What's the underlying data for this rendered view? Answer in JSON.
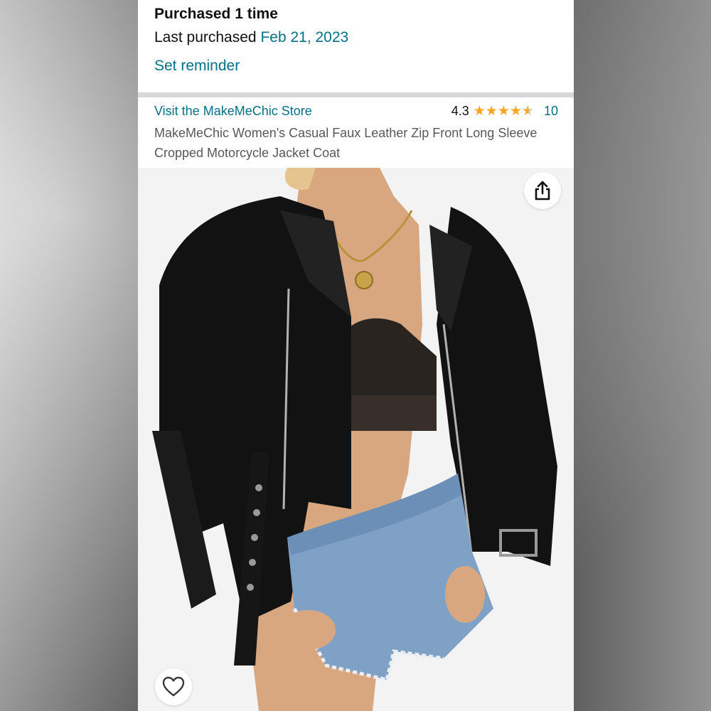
{
  "purchase": {
    "count_text": "Purchased 1 time",
    "last_label": "Last purchased",
    "last_date": "Feb 21, 2023",
    "reminder_label": "Set reminder"
  },
  "product": {
    "store_link": "Visit the MakeMeChic Store",
    "rating_value": "4.3",
    "rating_stars": 4.3,
    "rating_count": "10",
    "title": "MakeMeChic Women's Casual Faux Leather Zip Front Long Sleeve Cropped Motorcycle Jacket Coat"
  },
  "image": {
    "share_icon": "share-icon",
    "wishlist_icon": "heart-icon"
  },
  "colors": {
    "link": "#007185",
    "star": "#ffa41c",
    "text": "#0f1111",
    "muted_text": "#565959"
  }
}
